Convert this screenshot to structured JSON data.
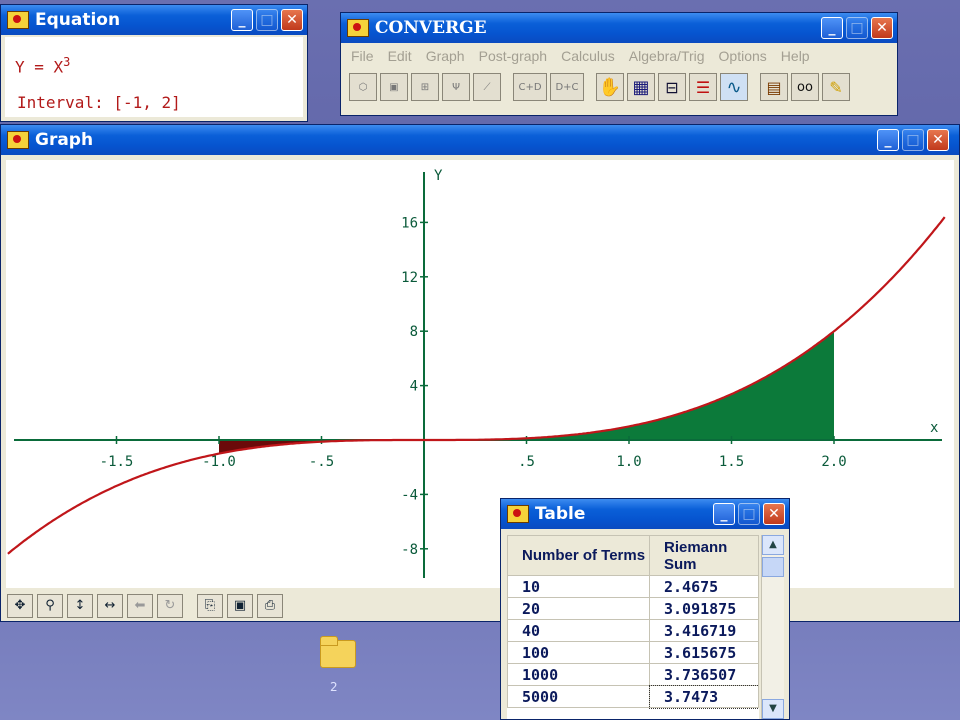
{
  "equation_window": {
    "title": "Equation",
    "equation": "Y = X",
    "exponent": "3",
    "interval": "Interval: [-1, 2]"
  },
  "converge_window": {
    "title": "CONVERGE",
    "menu": [
      "File",
      "Edit",
      "Graph",
      "Post-graph",
      "Calculus",
      "Algebra/Trig",
      "Options",
      "Help"
    ],
    "toolbar_labels": {
      "cd": "C+D",
      "dc": "D+C"
    }
  },
  "graph_window": {
    "title": "Graph",
    "x_axis_label": "x",
    "y_axis_label": "Y"
  },
  "table_window": {
    "title": "Table",
    "headers": [
      "Number of Terms",
      "Riemann Sum"
    ],
    "rows": [
      {
        "terms": "10",
        "sum": "2.4675"
      },
      {
        "terms": "20",
        "sum": "3.091875"
      },
      {
        "terms": "40",
        "sum": "3.416719"
      },
      {
        "terms": "100",
        "sum": "3.615675"
      },
      {
        "terms": "1000",
        "sum": "3.736507"
      },
      {
        "terms": "5000",
        "sum": "3.7473"
      }
    ]
  },
  "desktop": {
    "folder_label": "2"
  },
  "colors": {
    "curve": "#c0161a",
    "positive_area": "#0c7a3a",
    "negative_area": "#6b0a0a",
    "axis": "#0a6b3a"
  },
  "chart_data": {
    "type": "line",
    "title": "",
    "xlabel": "x",
    "ylabel": "Y",
    "function": "y = x^3",
    "x_range": [
      -2.0,
      2.5
    ],
    "y_range": [
      -10,
      19
    ],
    "xlim": [
      -2.0,
      2.5
    ],
    "ylim": [
      -10,
      19
    ],
    "x_ticks": [
      -1.5,
      -1.0,
      -0.5,
      0.5,
      1.0,
      1.5,
      2.0
    ],
    "x_tick_labels": [
      "-1.5",
      "-1.0",
      "-.5",
      ".5",
      "1.0",
      "1.5",
      "2.0"
    ],
    "y_ticks": [
      16,
      12,
      8,
      4,
      -4,
      -8
    ],
    "y_tick_labels": [
      "16",
      "12",
      "8",
      "4",
      "-4",
      "-8"
    ],
    "curve_x_range": [
      -2.03,
      2.54
    ],
    "shaded_interval": [
      -1,
      2
    ],
    "grid": false
  }
}
